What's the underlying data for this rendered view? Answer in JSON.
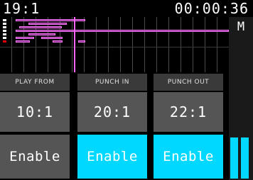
{
  "header": {
    "position": "19:1",
    "time": "00:00:36"
  },
  "monitor_label": "M",
  "columns": [
    {
      "label": "PLAY FROM",
      "value": "10:1",
      "button": "Enable",
      "enabled": false
    },
    {
      "label": "PUNCH IN",
      "value": "20:1",
      "button": "Enable",
      "enabled": true
    },
    {
      "label": "PUNCH OUT",
      "value": "22:1",
      "button": "Enable",
      "enabled": true
    }
  ],
  "colors": {
    "accent": "#00d8ff",
    "clip": "#ff77ff",
    "active_track": "#e00000"
  }
}
